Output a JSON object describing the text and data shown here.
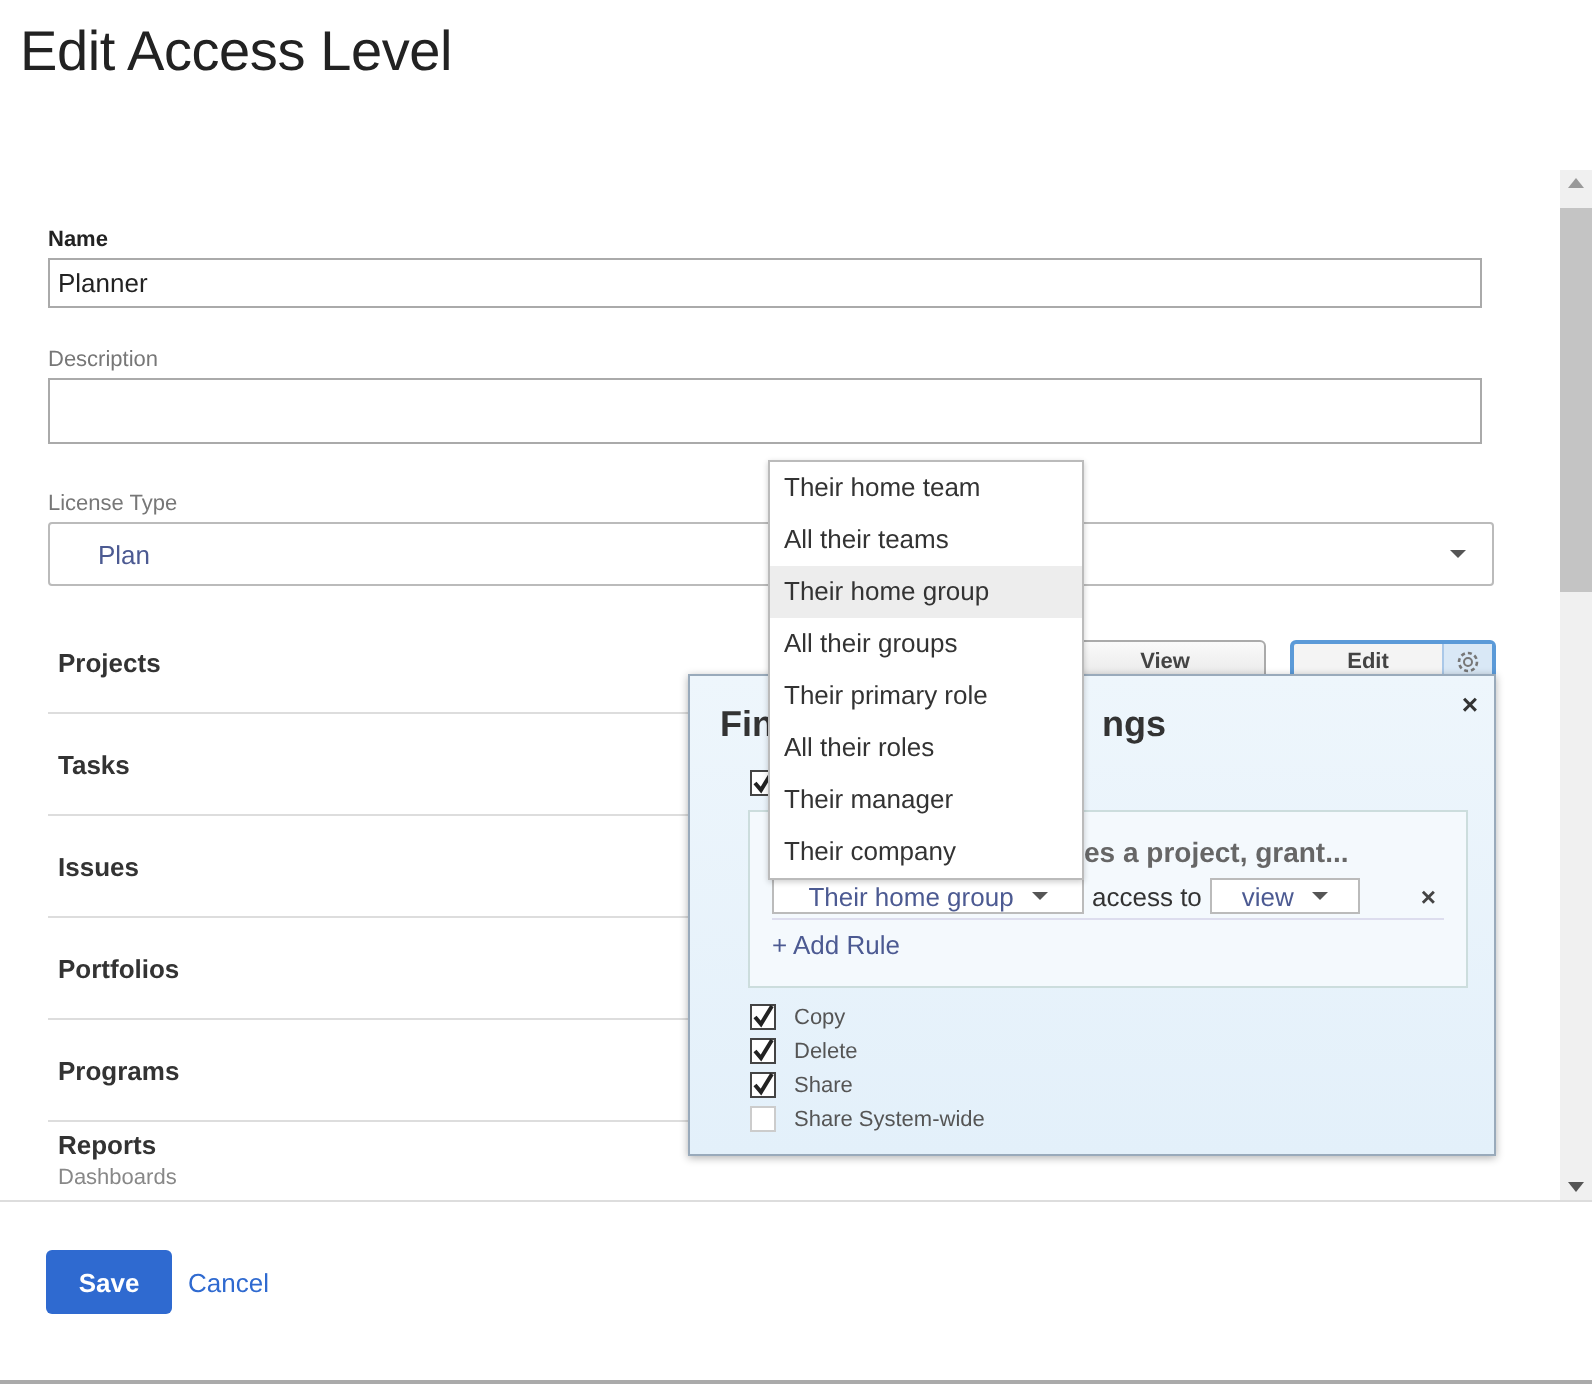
{
  "page_title": "Edit Access Level",
  "form": {
    "name": {
      "label": "Name",
      "value": "Planner"
    },
    "description": {
      "label": "Description"
    },
    "license_type": {
      "label": "License Type",
      "value": "Plan"
    }
  },
  "permissions": [
    {
      "label": "Projects",
      "buttons": [
        {
          "label": "View",
          "selected": false
        },
        {
          "label": "Edit",
          "selected": true
        }
      ]
    },
    {
      "label": "Tasks"
    },
    {
      "label": "Issues"
    },
    {
      "label": "Portfolios"
    },
    {
      "label": "Programs"
    },
    {
      "label": "Reports",
      "sublabel": "Dashboards"
    }
  ],
  "dropdown": {
    "items": [
      {
        "label": "Their home team",
        "selected": false
      },
      {
        "label": "All their teams",
        "selected": false
      },
      {
        "label": "Their home group",
        "selected": true
      },
      {
        "label": "All their groups",
        "selected": false
      },
      {
        "label": "Their primary role",
        "selected": false
      },
      {
        "label": "All their roles",
        "selected": false
      },
      {
        "label": "Their manager",
        "selected": false
      },
      {
        "label": "Their company",
        "selected": false
      }
    ]
  },
  "settings_popover": {
    "close": "×",
    "remove_rule": "×",
    "title_start": "Fin",
    "title_end": "ngs",
    "master_checked": true,
    "rule_heading": "es a project, grant...",
    "rule": {
      "subject": "Their home group",
      "connector": "access to",
      "access": "view"
    },
    "add_rule": "+ Add Rule",
    "options": [
      {
        "label": "Copy",
        "checked": true
      },
      {
        "label": "Delete",
        "checked": true
      },
      {
        "label": "Share",
        "checked": true
      },
      {
        "label": "Share System-wide",
        "checked": false
      }
    ]
  },
  "actions": {
    "save": "Save",
    "cancel": "Cancel"
  }
}
